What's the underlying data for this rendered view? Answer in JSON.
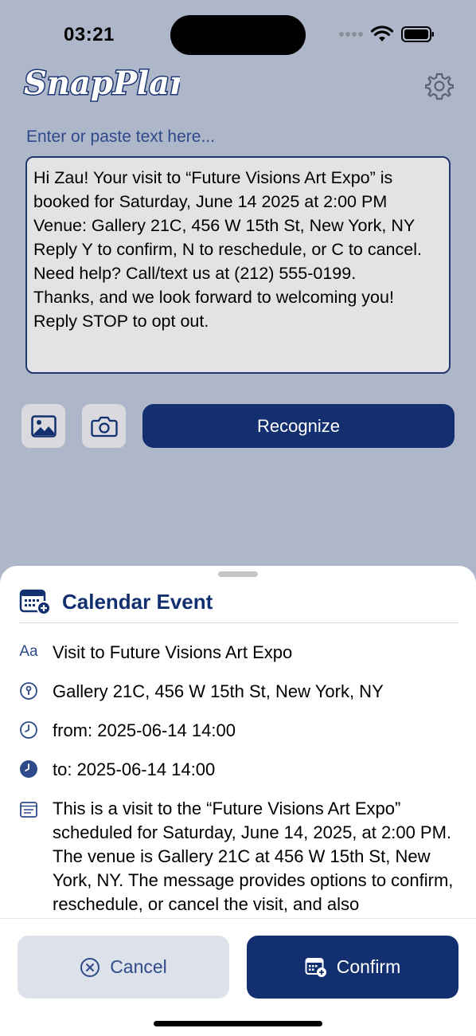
{
  "status_bar": {
    "time": "03:21"
  },
  "header": {
    "app_name": "SnapPlan"
  },
  "input": {
    "prompt": "Enter or paste text here...",
    "text": "Hi Zau! Your visit to “Future Visions Art Expo” is booked for Saturday, June 14 2025 at 2:00 PM\nVenue: Gallery 21C, 456 W 15th St, New York, NY\nReply Y to confirm, N to reschedule, or C to cancel.\nNeed help? Call/text us at (212) 555-0199.\nThanks, and we look forward to welcoming you!\nReply STOP to opt out."
  },
  "actions": {
    "recognize_label": "Recognize"
  },
  "sheet": {
    "title": "Calendar Event",
    "event_title": "Visit to Future Visions Art Expo",
    "location": "Gallery 21C, 456 W 15th St, New York, NY",
    "from": "from: 2025-06-14 14:00",
    "to": "to: 2025-06-14 14:00",
    "description": "This is a visit to the “Future Visions Art Expo” scheduled for Saturday, June 14, 2025, at 2:00 PM. The venue is Gallery 21C at 456 W 15th St, New York, NY. The message provides options to confirm, reschedule, or cancel the visit, and also",
    "cancel_label": "Cancel",
    "confirm_label": "Confirm"
  },
  "colors": {
    "accent": "#12306f",
    "background": "#aeb6c9",
    "prompt": "#2f4a8a"
  },
  "icons": [
    "gear-icon",
    "photo-icon",
    "camera-icon",
    "calendar-add-icon",
    "text-format-icon",
    "location-pin-icon",
    "clock-outline-icon",
    "clock-filled-icon",
    "note-icon",
    "cancel-circle-icon"
  ]
}
